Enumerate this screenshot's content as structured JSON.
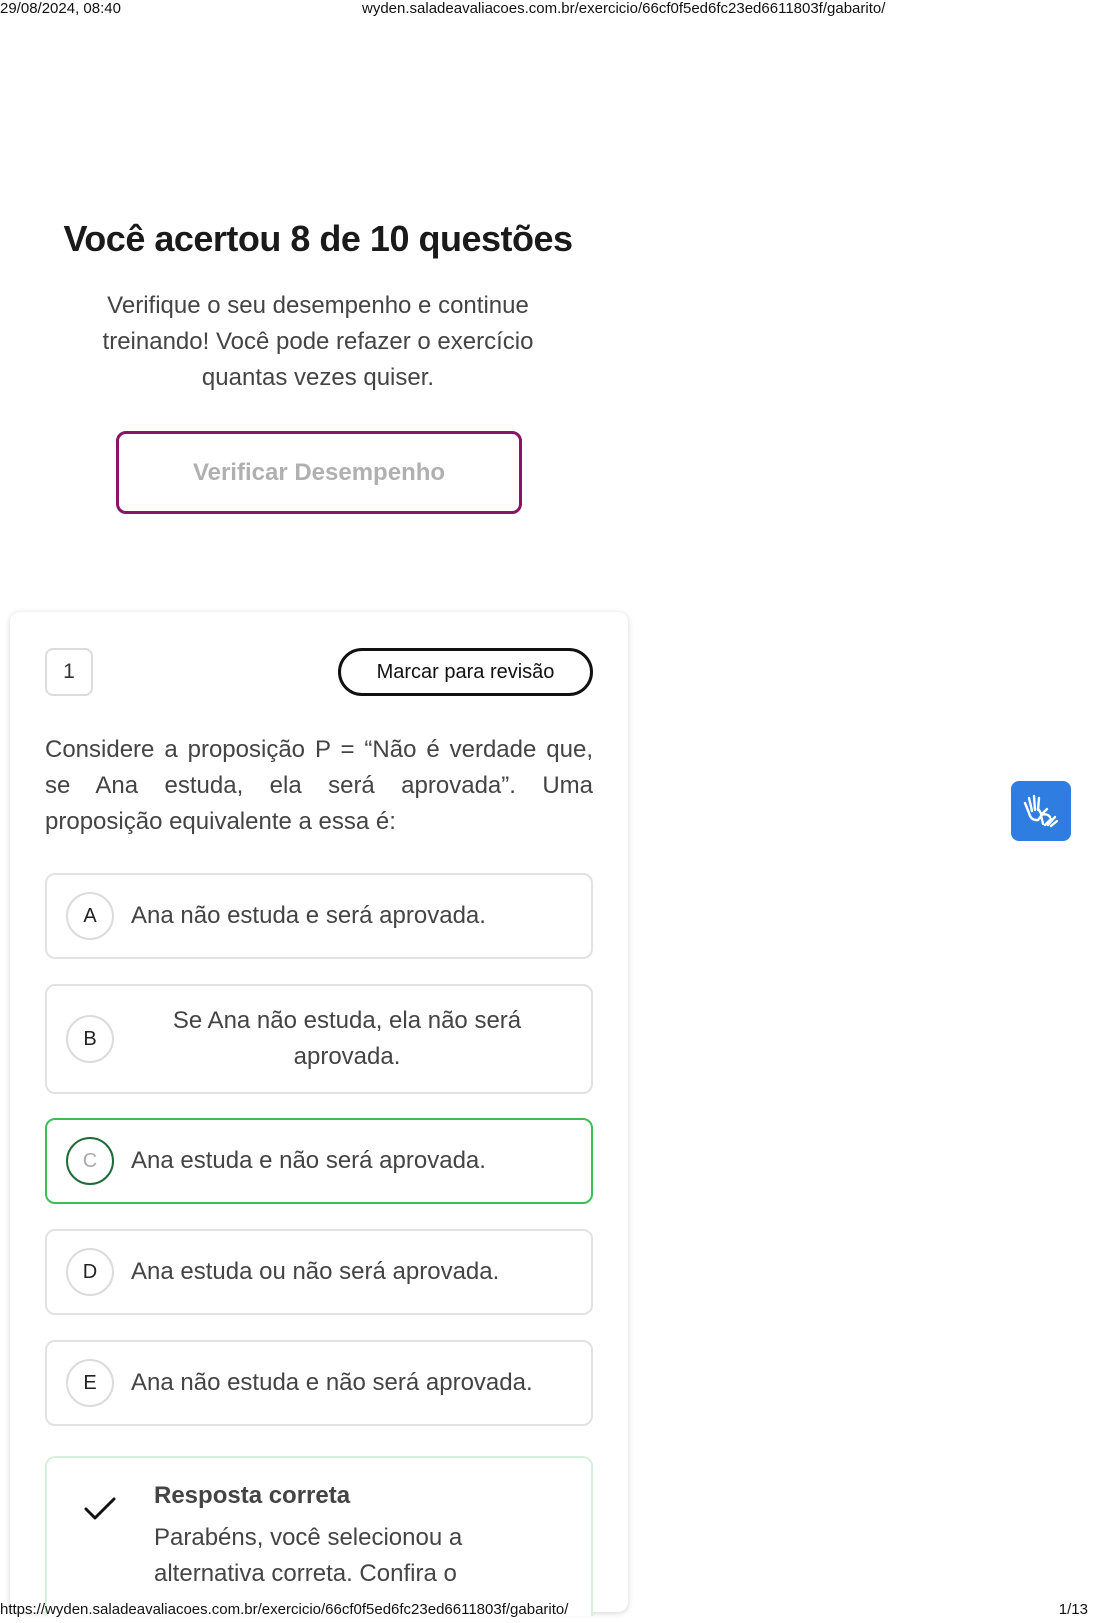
{
  "print_header": {
    "datetime": "29/08/2024, 08:40",
    "url": "wyden.saladeavaliacoes.com.br/exercicio/66cf0f5ed6fc23ed6611803f/gabarito/"
  },
  "print_footer": {
    "url": "https://wyden.saladeavaliacoes.com.br/exercicio/66cf0f5ed6fc23ed6611803f/gabarito/",
    "page": "1/13"
  },
  "summary": {
    "title": "Você acertou 8 de 10 questões",
    "subtitle": "Verifique o seu desempenho e continue treinando! Você pode refazer o exercício quantas vezes quiser.",
    "verify_button": "Verificar Desempenho"
  },
  "question": {
    "number": "1",
    "mark_review_button": "Marcar para revisão",
    "text": "Considere a proposição P = “Não é verdade que, se Ana estuda, ela será aprovada”. Uma proposição equivalente a essa é:",
    "options": [
      {
        "letter": "A",
        "text": "Ana não estuda e será aprovada."
      },
      {
        "letter": "B",
        "text": "Se Ana não estuda, ela não será aprovada."
      },
      {
        "letter": "C",
        "text": "Ana estuda e não será aprovada.",
        "state": "correct"
      },
      {
        "letter": "D",
        "text": "Ana estuda ou não será aprovada."
      },
      {
        "letter": "E",
        "text": "Ana não estuda e não será aprovada."
      }
    ]
  },
  "feedback": {
    "title": "Resposta correta",
    "body": "Parabéns, você selecionou a alternativa correta. Confira o"
  },
  "icons": {
    "answer_status": "check-icon",
    "accessibility": "sign-language-icon"
  },
  "colors": {
    "verify_border": "#8a1366",
    "correct_border": "#3cbf5a",
    "accessibility_bg": "#2f7de1"
  }
}
